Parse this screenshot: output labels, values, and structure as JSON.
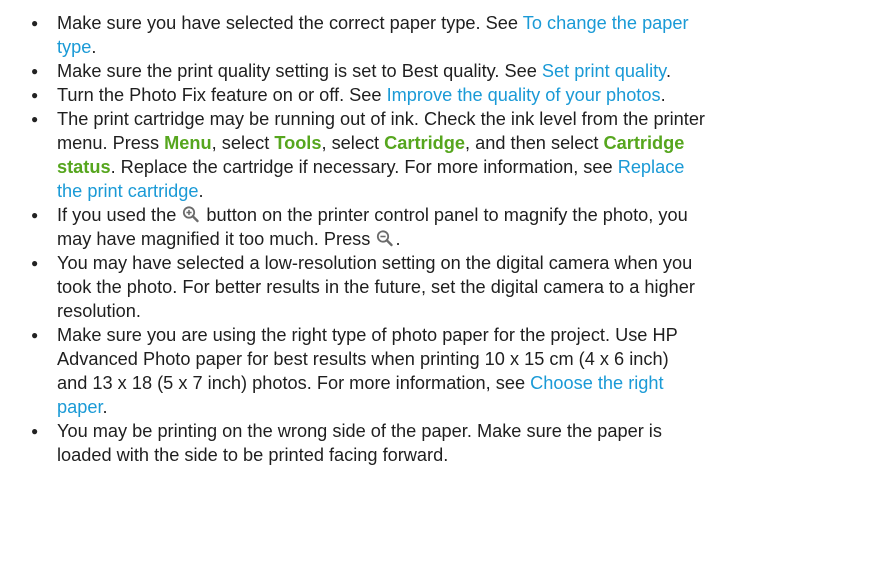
{
  "items": [
    {
      "l1_a": "Make sure you have selected the correct paper type. See ",
      "l1_link": "To change the paper",
      "l2_link": "type",
      "l2_b": "."
    },
    {
      "a": "Make sure the print quality setting is set to Best quality. See ",
      "link": "Set print quality",
      "b": "."
    },
    {
      "a": "Turn the Photo Fix feature on or off. See ",
      "link": "Improve the quality of your photos",
      "b": "."
    },
    {
      "l1": "The print cartridge may be running out of ink. Check the ink level from the printer",
      "l2_a": "menu. Press ",
      "l2_menu": "Menu",
      "l2_b": ", select ",
      "l2_tools": "Tools",
      "l2_c": ", select ",
      "l2_cartridge": "Cartridge",
      "l2_d": ", and then select ",
      "l2_cs": "Cartridge",
      "l3_status": "status",
      "l3_a": ". Replace the cartridge if necessary. For more information, see ",
      "l3_link": "Replace",
      "l4_link": "the print cartridge",
      "l4_b": "."
    },
    {
      "l1_a": "If you used the ",
      "l1_b": " button on the printer control panel to magnify the photo, you",
      "l2_a": "may have magnified it too much. Press ",
      "l2_b": ".",
      "zoom_in_icon": "zoom-in-icon",
      "zoom_out_icon": "zoom-out-icon"
    },
    {
      "l1": "You may have selected a low-resolution setting on the digital camera when you",
      "l2": "took the photo. For better results in the future, set the digital camera to a higher",
      "l3": "resolution."
    },
    {
      "l1": "Make sure you are using the right type of photo paper for the project. Use HP",
      "l2": "Advanced Photo paper for best results when printing 10 x 15 cm (4 x 6 inch)",
      "l3_a": "and 13 x 18  (5 x 7 inch) photos. For more information, see ",
      "l3_link": "Choose the right",
      "l4_link": "paper",
      "l4_b": "."
    },
    {
      "l1": "You may be printing on the wrong side of the paper. Make sure the paper is",
      "l2": "loaded with the side to be printed facing forward."
    }
  ],
  "bullet_char": "●",
  "colors": {
    "link": "#1a9ad6",
    "ui_keyword": "#56a61e",
    "text": "#1f1f1f"
  }
}
